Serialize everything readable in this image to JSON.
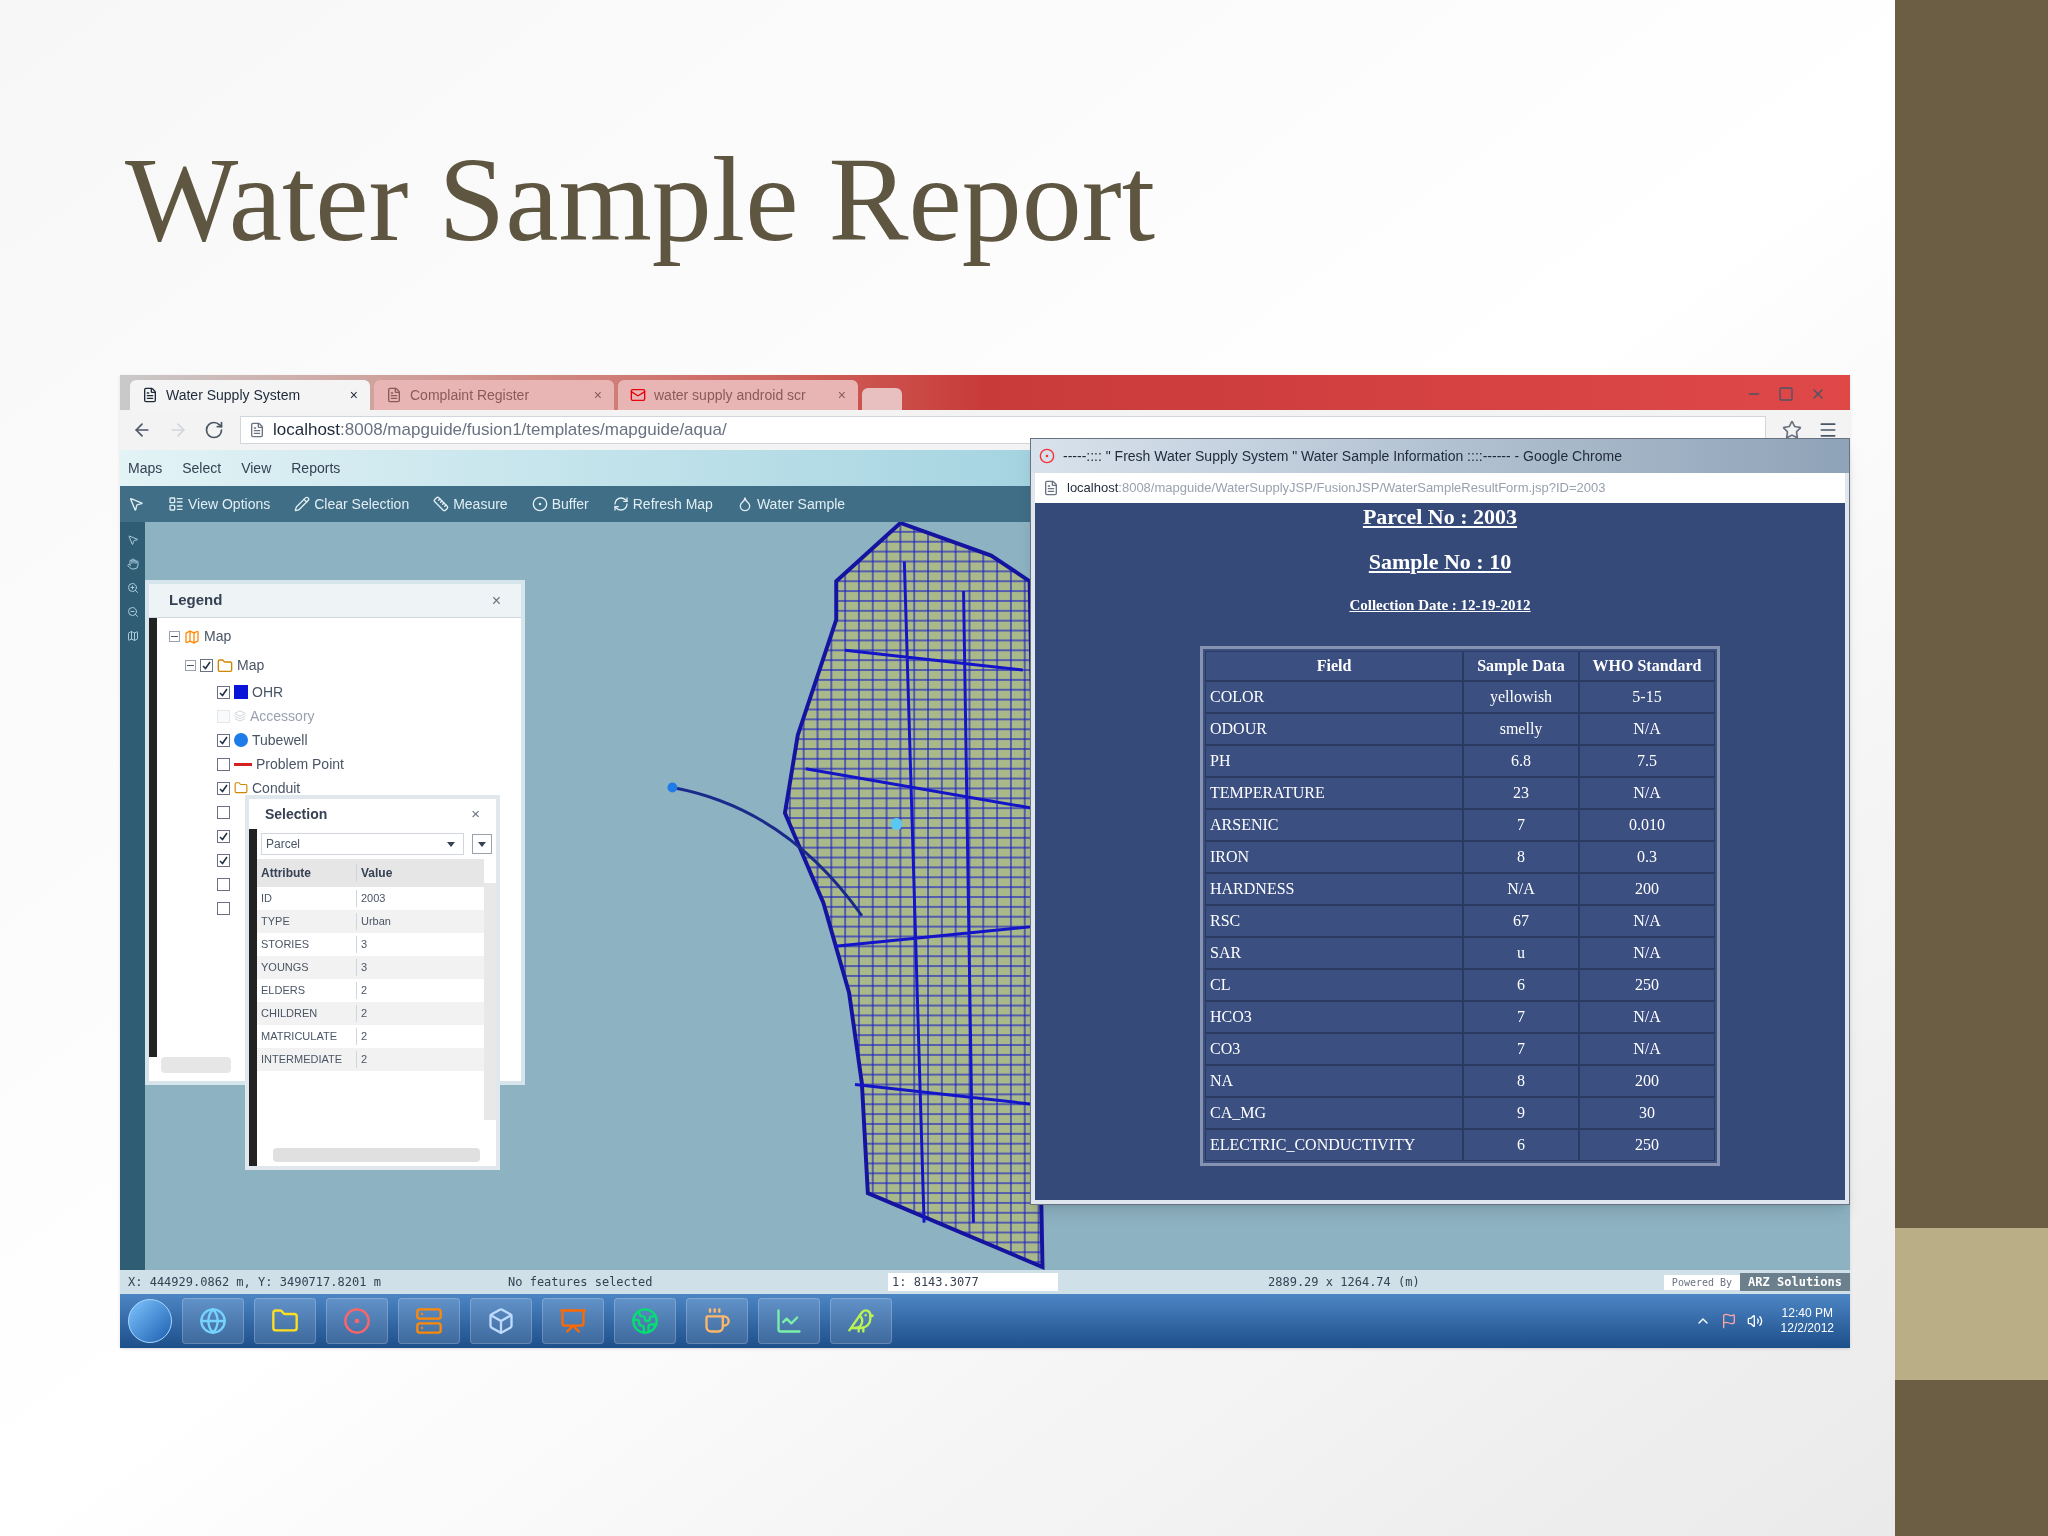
{
  "slide": {
    "title": "Water Sample Report"
  },
  "browser": {
    "tabs": [
      {
        "label": "Water Supply System",
        "selected": true,
        "close": "×"
      },
      {
        "label": "Complaint Register",
        "selected": false,
        "close": "×"
      },
      {
        "label": "water supply android scr",
        "selected": false,
        "close": "×"
      }
    ],
    "address": {
      "host": "localhost",
      "path": ":8008/mapguide/fusion1/templates/mapguide/aqua/"
    }
  },
  "menu": [
    "Maps",
    "Select",
    "View",
    "Reports"
  ],
  "toolbar": [
    "View Options",
    "Clear Selection",
    "Measure",
    "Buffer",
    "Refresh Map",
    "Water Sample"
  ],
  "legend": {
    "title": "Legend",
    "close": "×",
    "tree": [
      {
        "label": "Map",
        "expanded": true,
        "children": [
          {
            "label": "Map",
            "checked": true,
            "expanded": true,
            "children": [
              {
                "label": "OHR",
                "kind": "square",
                "color": "#0a14d8",
                "checked": true,
                "disabled": false
              },
              {
                "label": "Accessory",
                "kind": "none",
                "checked": false,
                "disabled": true
              },
              {
                "label": "Tubewell",
                "kind": "dot",
                "color": "#1e7be8",
                "checked": true,
                "disabled": false
              },
              {
                "label": "Problem Point",
                "kind": "line",
                "color": "#d42020",
                "checked": false,
                "disabled": false
              },
              {
                "label": "Conduit",
                "kind": "folder",
                "checked": true,
                "disabled": false
              },
              {
                "kind": "covered",
                "checked": false
              },
              {
                "kind": "covered",
                "checked": true
              },
              {
                "kind": "covered",
                "checked": true
              },
              {
                "kind": "covered",
                "checked": false
              },
              {
                "kind": "covered",
                "checked": false
              }
            ]
          }
        ]
      }
    ]
  },
  "selection": {
    "title": "Selection",
    "close": "×",
    "layer": "Parcel",
    "columns": [
      "Attribute",
      "Value"
    ],
    "rows": [
      [
        "ID",
        "2003"
      ],
      [
        "TYPE",
        "Urban"
      ],
      [
        "STORIES",
        "3"
      ],
      [
        "YOUNGS",
        "3"
      ],
      [
        "ELDERS",
        "2"
      ],
      [
        "CHILDREN",
        "2"
      ],
      [
        "MATRICULATE",
        "2"
      ],
      [
        "INTERMEDIATE",
        "2"
      ]
    ]
  },
  "popup": {
    "title": "-----:::: \" Fresh Water Supply System \" Water Sample Information ::::------ - Google Chrome",
    "host": "localhost",
    "path": ":8008/mapguide/WaterSupplyJSP/FusionJSP/WaterSampleResultForm.jsp?ID=2003",
    "parcel": "Parcel No : 2003",
    "sample": "Sample No : 10",
    "date": "Collection Date : 12-19-2012",
    "columns": [
      "Field",
      "Sample Data",
      "WHO Standard"
    ],
    "rows": [
      [
        "COLOR",
        "yellowish",
        "5-15"
      ],
      [
        "ODOUR",
        "smelly",
        "N/A"
      ],
      [
        "PH",
        "6.8",
        "7.5"
      ],
      [
        "TEMPERATURE",
        "23",
        "N/A"
      ],
      [
        "ARSENIC",
        "7",
        "0.010"
      ],
      [
        "IRON",
        "8",
        "0.3"
      ],
      [
        "HARDNESS",
        "N/A",
        "200"
      ],
      [
        "RSC",
        "67",
        "N/A"
      ],
      [
        "SAR",
        "u",
        "N/A"
      ],
      [
        "CL",
        "6",
        "250"
      ],
      [
        "HCO3",
        "7",
        "N/A"
      ],
      [
        "CO3",
        "7",
        "N/A"
      ],
      [
        "NA",
        "8",
        "200"
      ],
      [
        "CA_MG",
        "9",
        "30"
      ],
      [
        "ELECTRIC_CONDUCTIVITY",
        "6",
        "250"
      ]
    ]
  },
  "status_bar": {
    "coords": "X: 444929.0862 m, Y: 3490717.8201 m",
    "selection": "No features selected",
    "scale": "1: 8143.3077",
    "extent": "2889.29 x 1264.74 (m)",
    "powered_by": "Powered By",
    "brand": "ARZ Solutions"
  },
  "taskbar": {
    "time": "12:40 PM",
    "date": "12/2/2012"
  }
}
